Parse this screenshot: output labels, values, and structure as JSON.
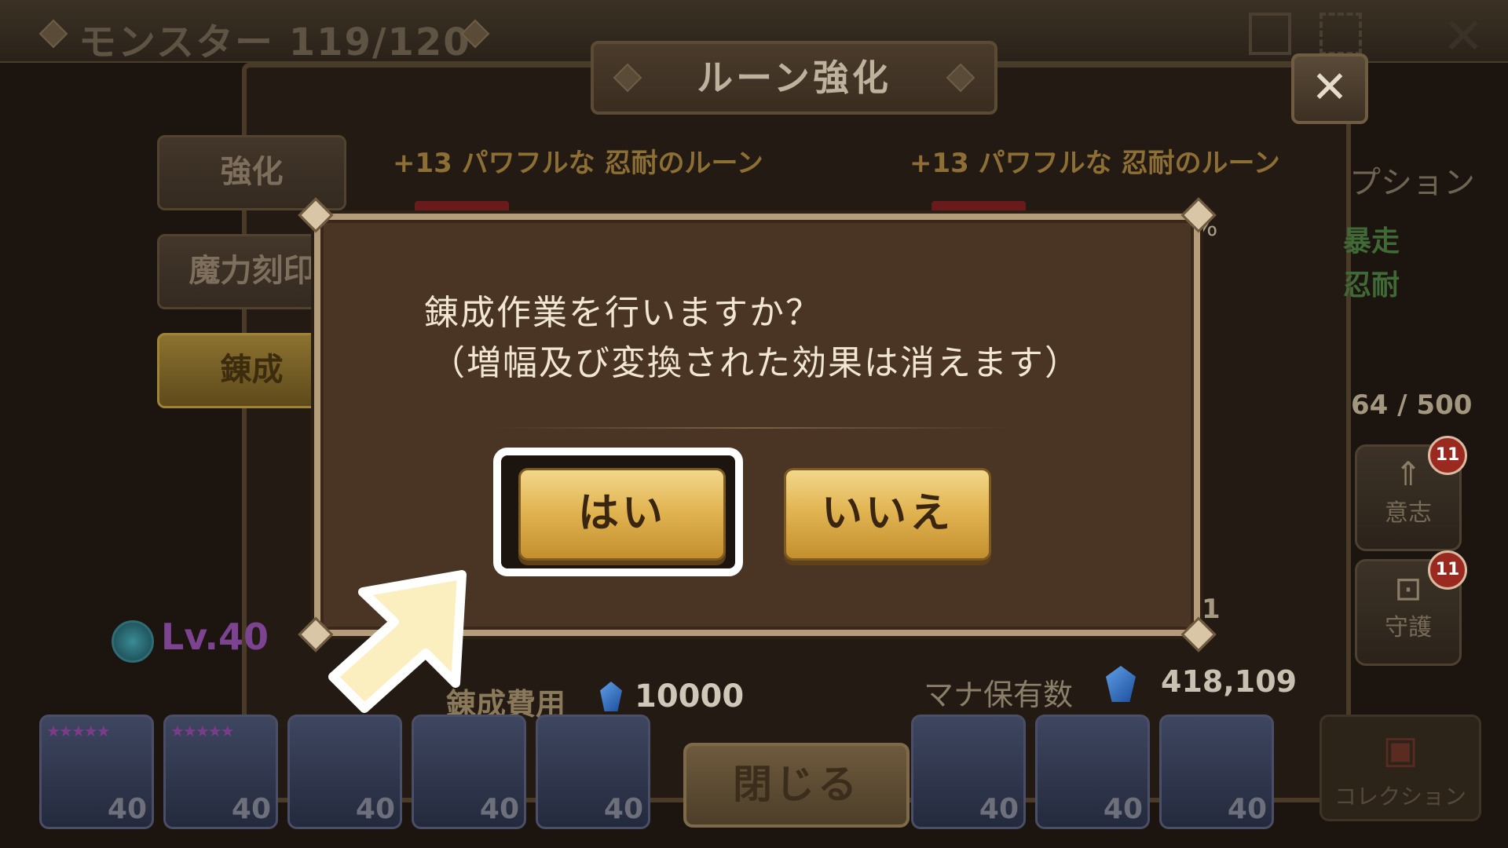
{
  "topbar": {
    "title": "モンスター 119/120"
  },
  "rune_panel": {
    "title": "ルーン強化",
    "tabs": [
      {
        "label": "強化"
      },
      {
        "label": "魔力刻印"
      },
      {
        "label": "錬成"
      }
    ],
    "rune_name_left": "+13 パワフルな 忍耐のルーン",
    "rune_name_right": "+13 パワフルな 忍耐のルーン",
    "percent_fragment": "%",
    "options_header": "プション",
    "option_1": "暴走",
    "option_2": "忍耐",
    "progress": "64 / 500",
    "slot_count": "1",
    "level": "Lv.40",
    "cost_label": "錬成費用",
    "cost_value": "10000",
    "mana_label": "マナ保有数",
    "mana_value": "418,109",
    "close_label": "閉じる",
    "side_buttons": [
      {
        "label": "意志",
        "badge": "11"
      },
      {
        "label": "守護",
        "badge": "11"
      }
    ],
    "collection_label": "コレクション"
  },
  "monsters": [
    {
      "level": "40"
    },
    {
      "level": "40"
    },
    {
      "level": "40"
    },
    {
      "level": "40"
    },
    {
      "level": "40"
    },
    {
      "level": "40"
    },
    {
      "level": "40"
    },
    {
      "level": "40"
    }
  ],
  "dialog": {
    "line1": "錬成作業を行いますか？",
    "line2": "（増幅及び変換された効果は消えます）",
    "yes_label": "はい",
    "no_label": "いいえ"
  },
  "colors": {
    "dialog_bg": "#4a3424",
    "button_gold": "#e2b553",
    "highlight_frame": "#ffffff",
    "arrow_fill": "#fbefc0"
  }
}
